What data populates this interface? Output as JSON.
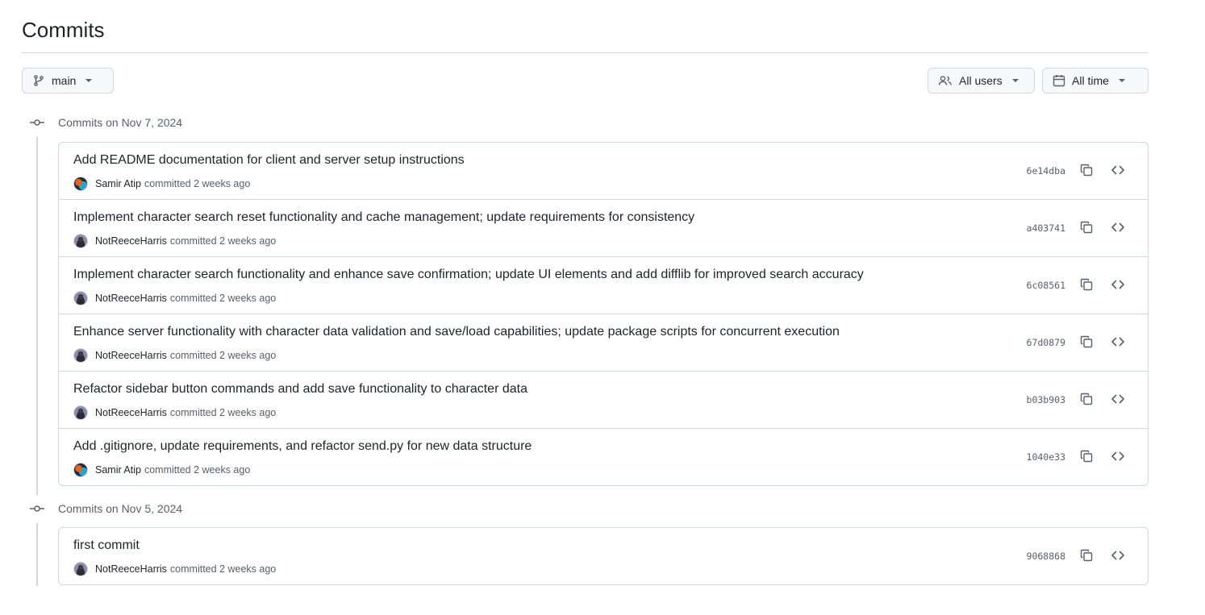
{
  "page": {
    "title": "Commits"
  },
  "toolbar": {
    "branch_label": "main",
    "users_label": "All users",
    "time_label": "All time"
  },
  "groups": [
    {
      "title": "Commits on Nov 7, 2024",
      "commits": [
        {
          "message": "Add README documentation for client and server setup instructions",
          "author": "Samir Atip",
          "avatar": "samir",
          "meta": "committed 2 weeks ago",
          "sha": "6e14dba"
        },
        {
          "message": "Implement character search reset functionality and cache management; update requirements for consistency",
          "author": "NotReeceHarris",
          "avatar": "reece",
          "meta": "committed 2 weeks ago",
          "sha": "a403741"
        },
        {
          "message": "Implement character search functionality and enhance save confirmation; update UI elements and add difflib for improved search accuracy",
          "author": "NotReeceHarris",
          "avatar": "reece",
          "meta": "committed 2 weeks ago",
          "sha": "6c08561"
        },
        {
          "message": "Enhance server functionality with character data validation and save/load capabilities; update package scripts for concurrent execution",
          "author": "NotReeceHarris",
          "avatar": "reece",
          "meta": "committed 2 weeks ago",
          "sha": "67d0879"
        },
        {
          "message": "Refactor sidebar button commands and add save functionality to character data",
          "author": "NotReeceHarris",
          "avatar": "reece",
          "meta": "committed 2 weeks ago",
          "sha": "b03b903"
        },
        {
          "message": "Add .gitignore, update requirements, and refactor send.py for new data structure",
          "author": "Samir Atip",
          "avatar": "samir",
          "meta": "committed 2 weeks ago",
          "sha": "1040e33"
        }
      ]
    },
    {
      "title": "Commits on Nov 5, 2024",
      "commits": [
        {
          "message": "first commit",
          "author": "NotReeceHarris",
          "avatar": "reece",
          "meta": "committed 2 weeks ago",
          "sha": "9068868"
        }
      ]
    }
  ],
  "icons": {
    "branch": "git-branch-icon",
    "users": "people-icon",
    "time": "calendar-icon",
    "commit": "git-commit-icon",
    "copy": "copy-icon",
    "browse": "code-icon"
  }
}
